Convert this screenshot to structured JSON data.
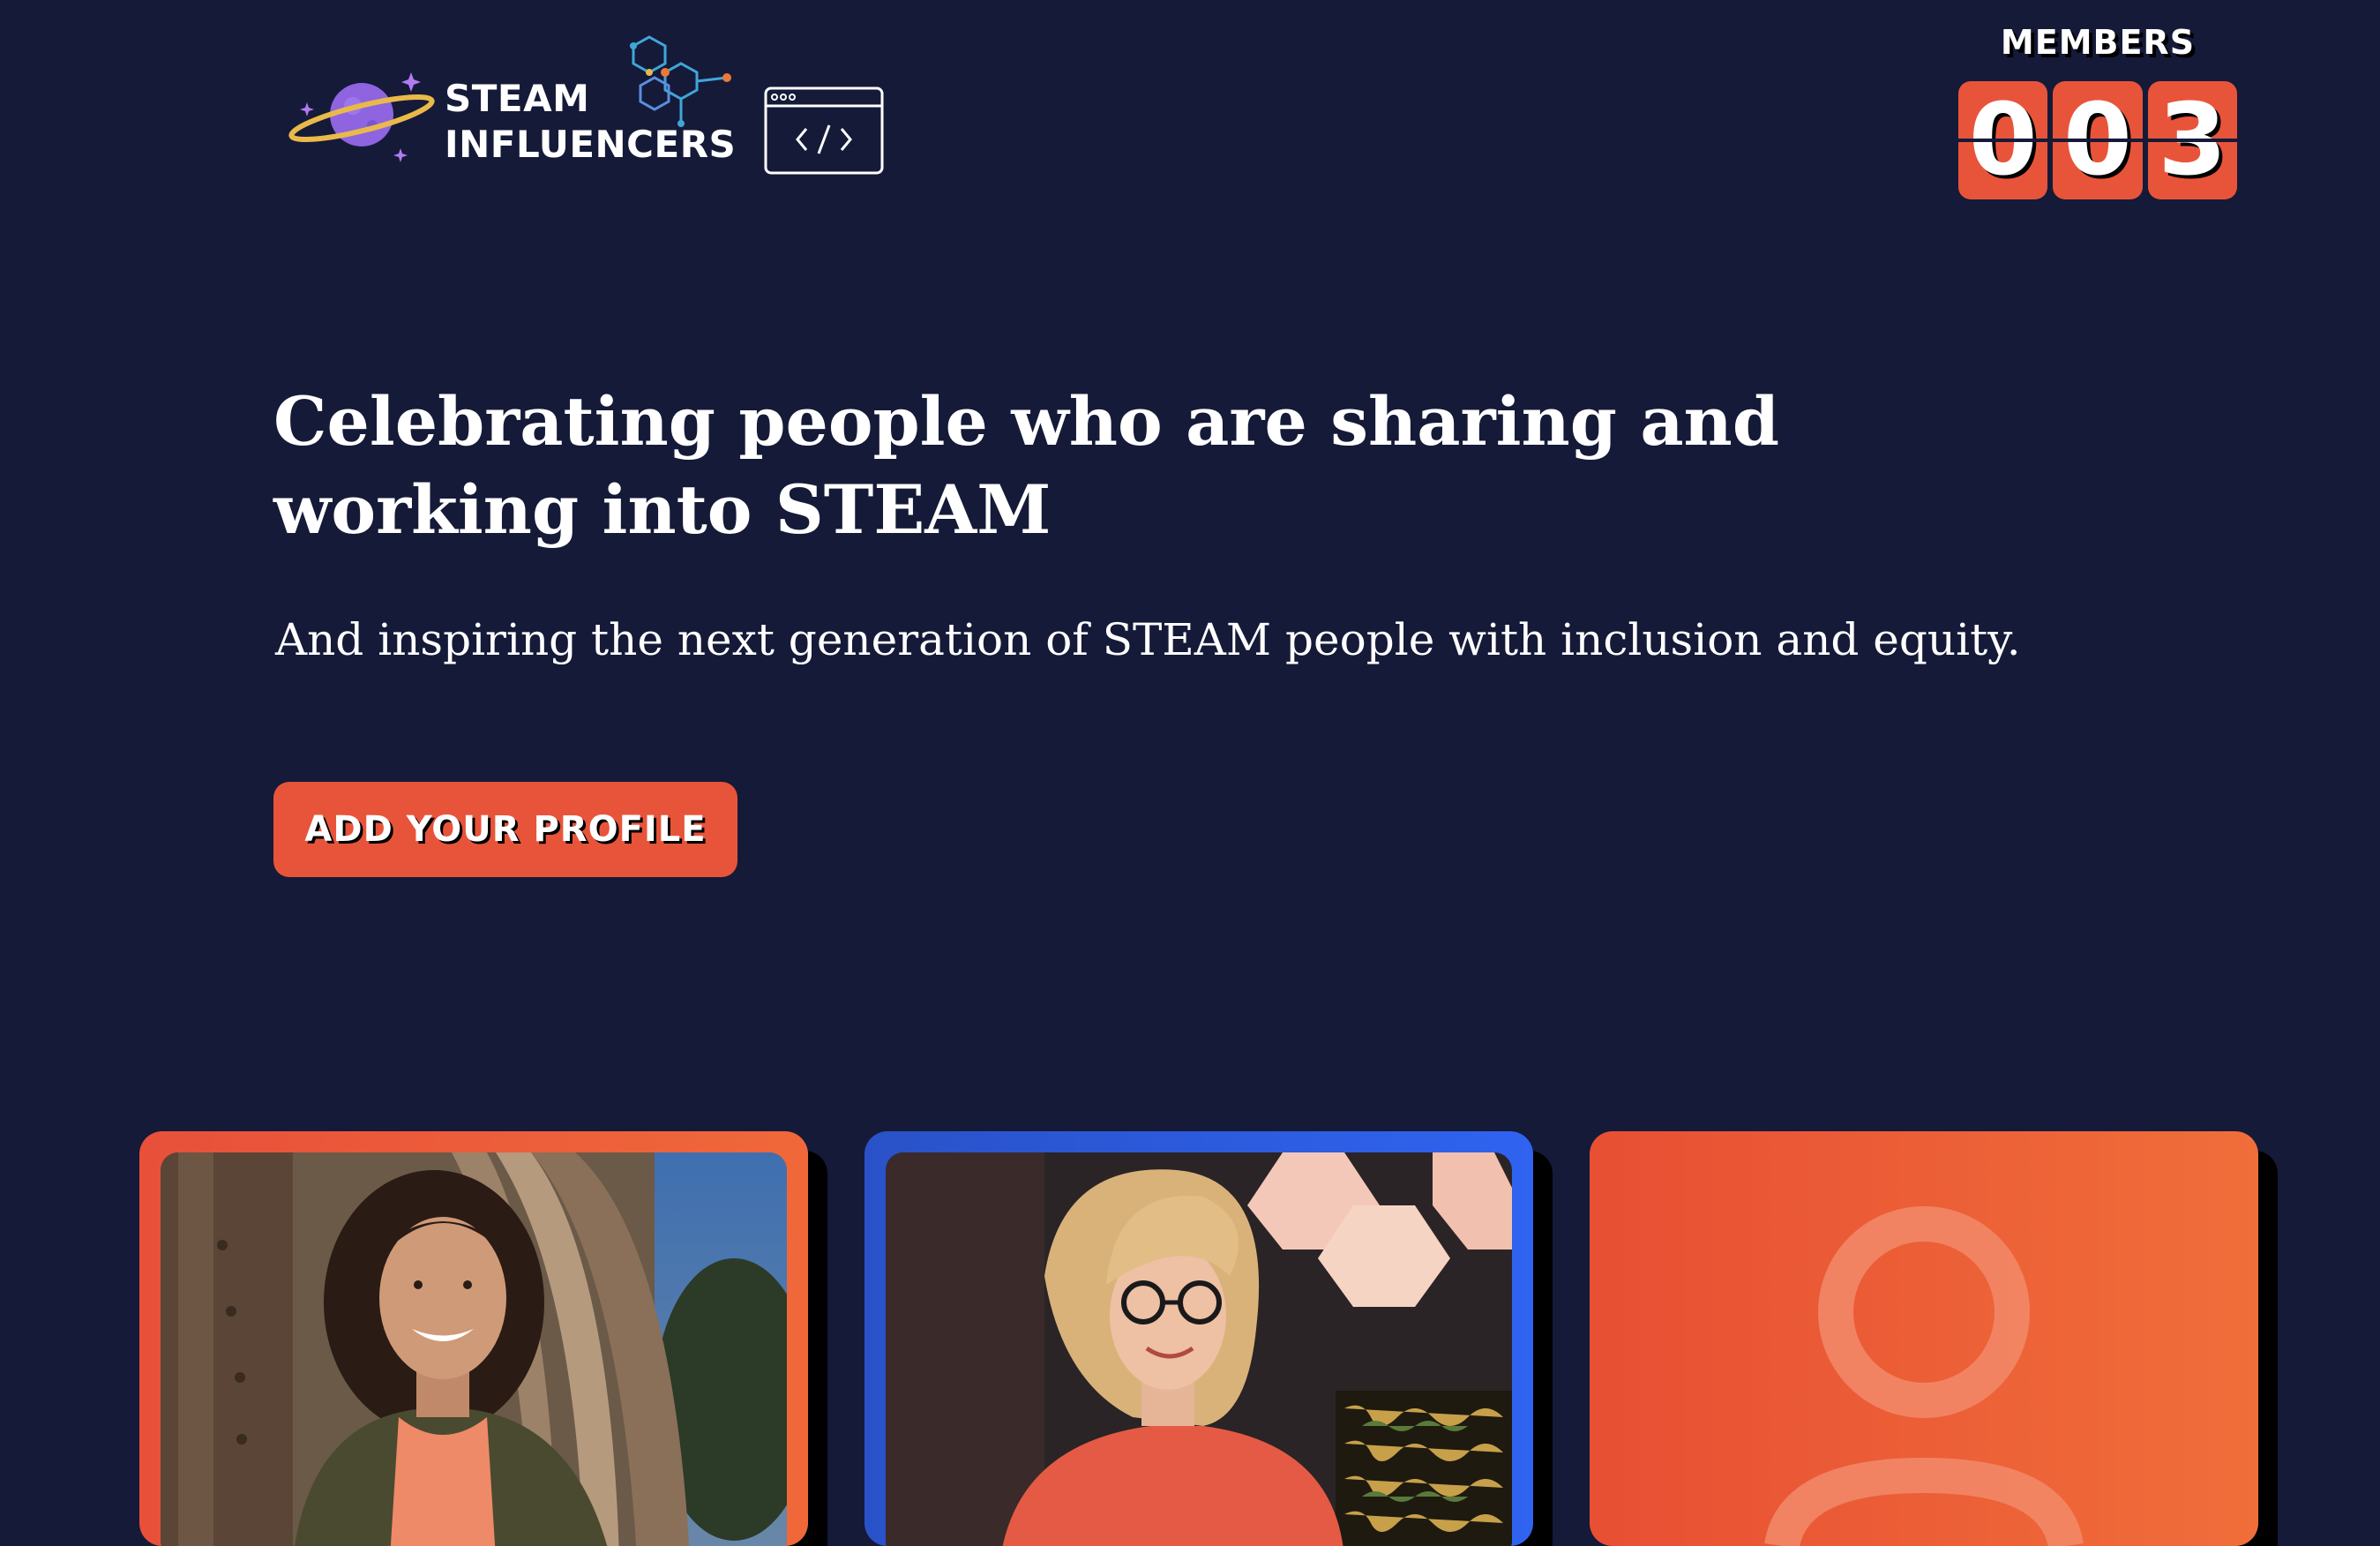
{
  "brand": {
    "line1": "STEAM",
    "line2": "INFLUENCERS",
    "icons": [
      "planet-icon",
      "molecule-icon",
      "code-window-icon"
    ]
  },
  "members": {
    "label": "MEMBERS",
    "digits": [
      "0",
      "0",
      "3"
    ]
  },
  "hero": {
    "title": "Celebrating people who are sharing and working into STEAM",
    "subtitle": "And inspiring the next generation of STEAM people with inclusion and equity.",
    "cta_label": "ADD YOUR PROFILE"
  },
  "cards": [
    {
      "type": "photo",
      "border_color": "#ea5a3a"
    },
    {
      "type": "photo",
      "border_color": "#2c5be0"
    },
    {
      "type": "placeholder",
      "icon": "user-placeholder-icon",
      "background": "#ec5f37"
    }
  ],
  "colors": {
    "background": "#151a38",
    "accent": "#e8543a",
    "text": "#ffffff"
  }
}
